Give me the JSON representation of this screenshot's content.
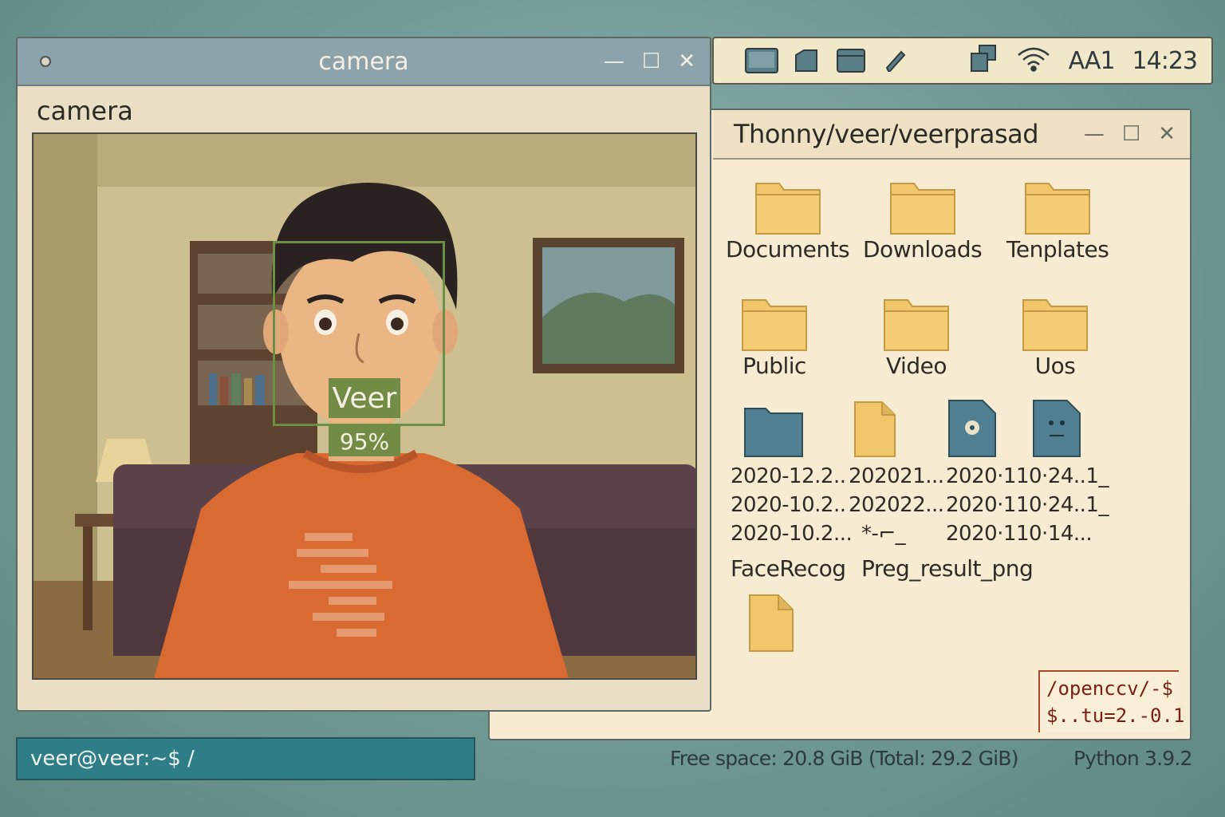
{
  "top_panel": {
    "icons": [
      "window-icon",
      "box-icon",
      "browser-icon",
      "pencil-icon"
    ],
    "tray_icons": [
      "network-stack-icon",
      "wifi-icon"
    ],
    "input_indicator": "AA1",
    "clock": "14:23"
  },
  "file_manager": {
    "title": "Thonny/veer/veerprasad",
    "folders": [
      {
        "label": "Documents"
      },
      {
        "label": "Downloads"
      },
      {
        "label": "Tenplates"
      },
      {
        "label": "Public"
      },
      {
        "label": "Video"
      },
      {
        "label": "Uos"
      }
    ],
    "files": {
      "col1": [
        "2020-12.2..",
        "2020-10.2..",
        "2020-10.2..."
      ],
      "col2": [
        "202021...",
        "202022...",
        "*‐⌐_"
      ],
      "col3": [
        "2020·110·24..1_",
        "2020·110·24..1_",
        "2020·110·14..."
      ],
      "folder_label": "FaceRecog",
      "file_label": "Preg_result_png"
    },
    "terminal_overlay": {
      "line1": "/openccv/-$",
      "line2": "$..tu=2.-0.1"
    }
  },
  "camera_window": {
    "title": "camera",
    "label": "camera",
    "detection": {
      "name": "Veer",
      "confidence": "95%"
    }
  },
  "terminal": {
    "prompt": "veer@veer:~$ /"
  },
  "status": {
    "free_space": "Free space: 20.8 GiB (Total: 29.2 GiB)",
    "python": "Python 3.9.2"
  },
  "colors": {
    "desktop": "#6f9892",
    "folder": "#f2c66a",
    "file_blue": "#4f7f91",
    "detection_box": "#6c8f45",
    "terminal_bg": "#2f7d86"
  }
}
